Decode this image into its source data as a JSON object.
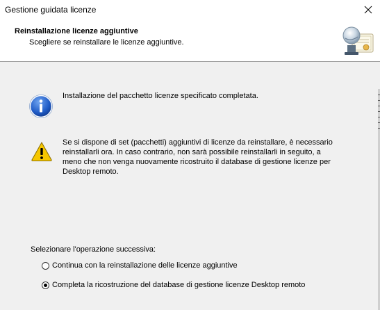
{
  "window": {
    "title": "Gestione guidata licenze",
    "close_glyph": "✕"
  },
  "header": {
    "title": "Reinstallazione licenze aggiuntive",
    "subtitle": "Scegliere se reinstallare le licenze aggiuntive.",
    "icon": "license-server-certificate-icon"
  },
  "info": {
    "icon": "info-icon",
    "text": "Installazione del pacchetto licenze specificato completata."
  },
  "warning": {
    "icon": "warning-icon",
    "lines": [
      "Se si dispone di set (pacchetti) aggiuntivi di licenze da reinstallare, è necessario",
      "reinstallarli ora. In caso contrario, non sarà possibile reinstallarli in seguito, a",
      "meno che non venga nuovamente ricostruito il database di gestione licenze per",
      "Desktop remoto."
    ]
  },
  "options": {
    "prompt": "Selezionare l'operazione successiva:",
    "items": [
      {
        "label": "Continua con la reinstallazione delle licenze aggiuntive",
        "checked": false
      },
      {
        "label": "Completa la ricostruzione del database di gestione licenze Desktop remoto",
        "checked": true
      }
    ]
  }
}
